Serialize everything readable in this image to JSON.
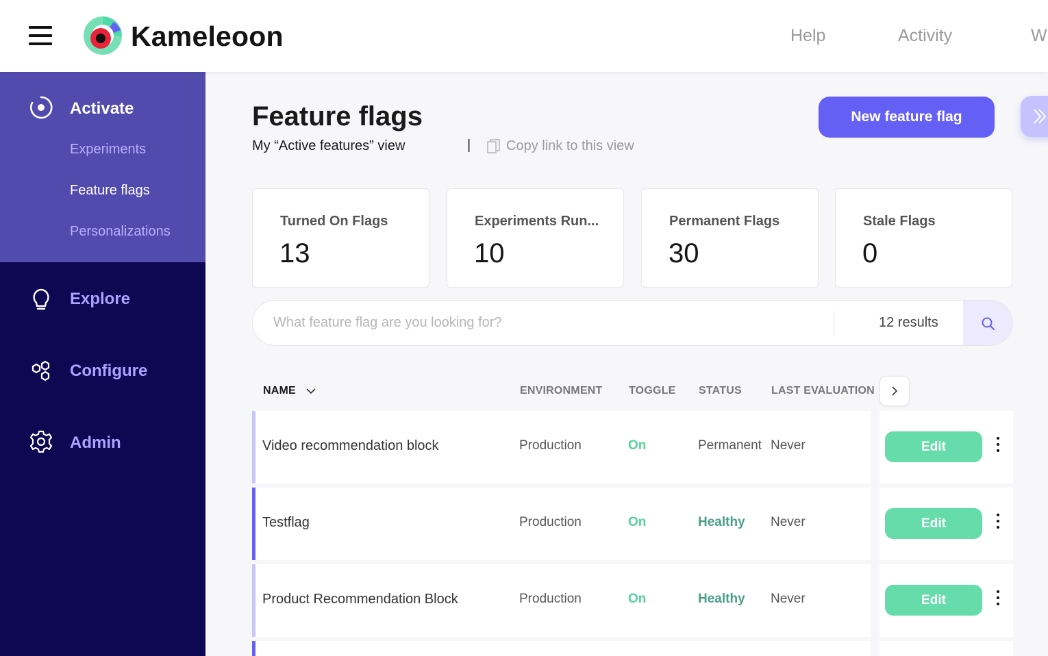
{
  "topbar": {
    "brand": "Kameleoon",
    "nav": [
      "Help",
      "Activity",
      "W"
    ],
    "icons": {
      "menu": "hamburger-menu-icon",
      "logo": "kameleoon-logo"
    }
  },
  "sidebar": {
    "sections": [
      {
        "label": "Activate",
        "icon": "target-icon",
        "active": true,
        "items": [
          {
            "label": "Experiments",
            "current": false
          },
          {
            "label": "Feature flags",
            "current": true
          },
          {
            "label": "Personalizations",
            "current": false
          }
        ]
      },
      {
        "label": "Explore",
        "icon": "lightbulb-icon"
      },
      {
        "label": "Configure",
        "icon": "hexagons-icon"
      },
      {
        "label": "Admin",
        "icon": "gear-icon"
      }
    ],
    "colors": {
      "active_bg": "#524bae",
      "bg": "#0e0752",
      "accent": "#a9a4ff"
    }
  },
  "header": {
    "title": "Feature flags",
    "view_name": "My “Active features” view",
    "divider": "|",
    "copy_link": "Copy link to this view",
    "new_button": "New feature flag"
  },
  "stats": [
    {
      "label": "Turned On Flags",
      "value": "13"
    },
    {
      "label": "Experiments Run...",
      "value": "10"
    },
    {
      "label": "Permanent Flags",
      "value": "30"
    },
    {
      "label": "Stale Flags",
      "value": "0"
    }
  ],
  "search": {
    "placeholder": "What feature flag are you looking for?",
    "value": "",
    "results": "12 results"
  },
  "table": {
    "columns": [
      "NAME",
      "ENVIRONMENT",
      "TOGGLE",
      "STATUS",
      "LAST EVALUATION"
    ],
    "rows": [
      {
        "name": "Video recommendation block",
        "environment": "Production",
        "toggle": "On",
        "status": "Permanent",
        "last": "Never",
        "edit": "Edit",
        "accent": "#c9c6ff"
      },
      {
        "name": "Testflag",
        "environment": "Production",
        "toggle": "On",
        "status": "Healthy",
        "last": "Never",
        "edit": "Edit",
        "accent": "#6460f6"
      },
      {
        "name": "Product Recommendation Block",
        "environment": "Production",
        "toggle": "On",
        "status": "Healthy",
        "last": "Never",
        "edit": "Edit",
        "accent": "#c9c6ff"
      }
    ]
  },
  "colors": {
    "primary": "#6460f6",
    "edit": "#67dcab",
    "on": "#54d29b",
    "healthy": "#4a9e86"
  }
}
